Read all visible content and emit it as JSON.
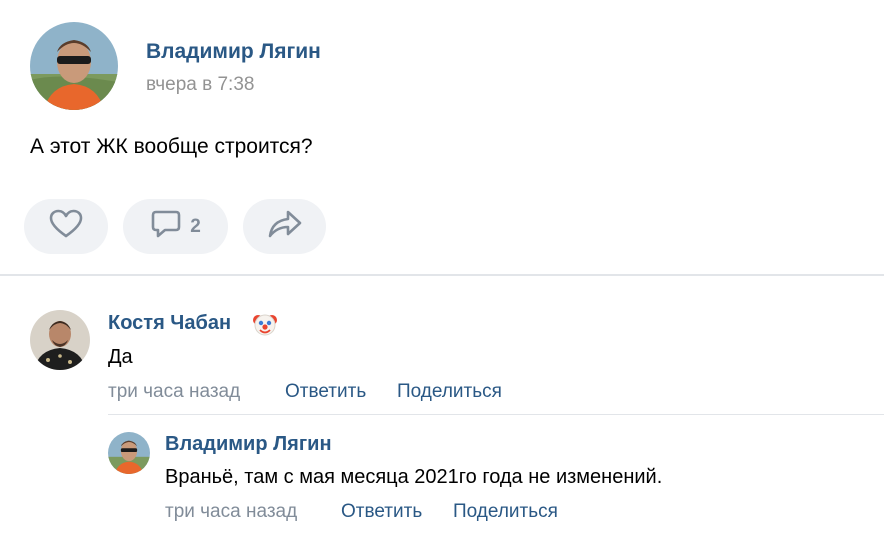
{
  "post": {
    "author": "Владимир Лягин",
    "time": "вчера в 7:38",
    "text": "А этот ЖК вообще строится?",
    "actions": {
      "like_icon": "heart-icon",
      "comment_icon": "speech-bubble-icon",
      "comment_count": "2",
      "share_icon": "share-arrow-icon"
    }
  },
  "comments": [
    {
      "author": "Костя Чабан",
      "badge_icon": "clown-face-emoji",
      "text": "Да",
      "time": "три часа назад",
      "reply_label": "Ответить",
      "share_label": "Поделиться"
    }
  ],
  "replies": [
    {
      "author": "Владимир Лягин",
      "text": "Враньё, там с мая месяца 2021го года не изменений.",
      "time": "три часа назад",
      "reply_label": "Ответить",
      "share_label": "Поделиться"
    }
  ],
  "colors": {
    "link": "#2a5885",
    "muted": "#818c99",
    "pill_bg": "#f0f2f5",
    "divider": "#e2e5e9"
  }
}
